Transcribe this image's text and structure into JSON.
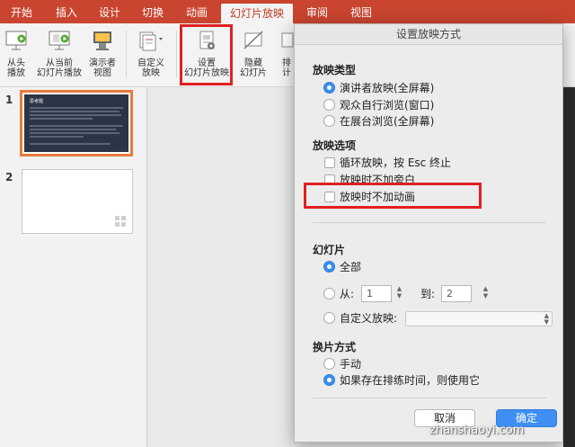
{
  "ribbon_tabs": [
    "开始",
    "插入",
    "设计",
    "切换",
    "动画",
    "幻灯片放映",
    "审阅",
    "视图"
  ],
  "active_tab": "幻灯片放映",
  "ribbon_buttons": {
    "from_start": {
      "line1": "从头",
      "line2": "播放",
      "icon": "play-screen-icon"
    },
    "from_current": {
      "line1": "从当前",
      "line2": "幻灯片播放",
      "icon": "play-current-icon"
    },
    "presenter_view": {
      "line1": "演示者",
      "line2": "视图",
      "icon": "presenter-view-icon"
    },
    "custom_show": {
      "line1": "自定义",
      "line2": "放映",
      "icon": "custom-show-icon"
    },
    "setup_show": {
      "line1": "设置",
      "line2": "幻灯片放映",
      "icon": "setup-show-icon"
    },
    "hide_slide": {
      "line1": "隐藏",
      "line2": "幻灯片",
      "icon": "hide-slide-icon"
    },
    "rehearse": {
      "line1": "排",
      "line2": "计",
      "icon": "rehearse-icon"
    }
  },
  "slides": {
    "slide1_number": "1",
    "slide1_title": "思考题",
    "slide2_number": "2"
  },
  "dialog": {
    "title": "设置放映方式",
    "show_type_label": "放映类型",
    "show_type_options": [
      "演讲者放映(全屏幕)",
      "观众自行浏览(窗口)",
      "在展台浏览(全屏幕)"
    ],
    "show_type_selected": "演讲者放映(全屏幕)",
    "show_options_label": "放映选项",
    "show_options": [
      "循环放映，按 Esc 终止",
      "放映时不加旁白",
      "放映时不加动画"
    ],
    "slides_label": "幻灯片",
    "slides_all": "全部",
    "slides_from": "从:",
    "slides_from_value": "1",
    "slides_to": "到:",
    "slides_to_value": "2",
    "slides_custom": "自定义放映:",
    "advance_label": "换片方式",
    "advance_manual": "手动",
    "advance_timings": "如果存在排练时间，则使用它",
    "cancel_label": "取消",
    "ok_label": "确定"
  },
  "watermark": "zhanshaoyi.com",
  "colors": {
    "tab_bar": "#c9452f",
    "highlight": "#e02020",
    "primary_button": "#3f8ef3"
  }
}
